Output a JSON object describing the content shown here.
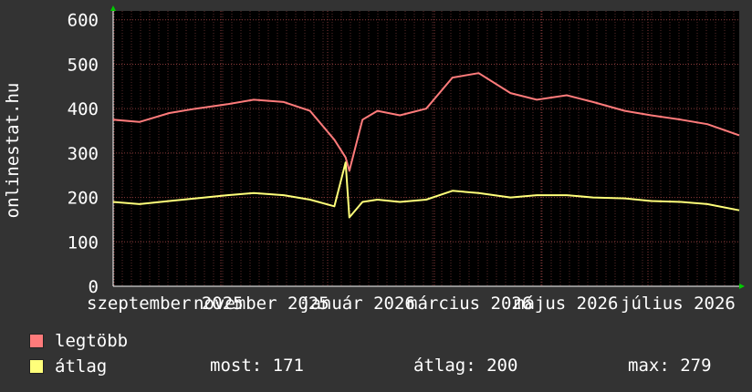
{
  "chart_data": {
    "type": "line",
    "ylabel": "onlinestat.hu",
    "ylim": [
      0,
      620
    ],
    "y_ticks": [
      0,
      100,
      200,
      300,
      400,
      500,
      600
    ],
    "x_tick_labels": [
      "szeptember 2025",
      "november 2025",
      "január 2026",
      "március 2026",
      "május 2026",
      "július 2026"
    ],
    "x_range": [
      "2025-09-01",
      "2026-08-01"
    ],
    "grid": true,
    "series": [
      {
        "name": "legtöbb",
        "color": "#ff7b7b",
        "x_dates": [
          "2025-09-01",
          "2025-09-15",
          "2025-10-01",
          "2025-10-15",
          "2025-11-01",
          "2025-11-15",
          "2025-12-01",
          "2025-12-15",
          "2025-12-28",
          "2026-01-03",
          "2026-01-05",
          "2026-01-12",
          "2026-01-20",
          "2026-02-01",
          "2026-02-15",
          "2026-03-01",
          "2026-03-15",
          "2026-04-01",
          "2026-04-15",
          "2026-05-01",
          "2026-05-15",
          "2026-06-01",
          "2026-06-15",
          "2026-07-01",
          "2026-07-15",
          "2026-08-01"
        ],
        "values": [
          375,
          370,
          390,
          400,
          410,
          420,
          415,
          395,
          330,
          290,
          260,
          375,
          395,
          385,
          400,
          470,
          480,
          435,
          420,
          430,
          415,
          395,
          385,
          375,
          365,
          340
        ]
      },
      {
        "name": "átlag",
        "color": "#ffff7a",
        "x_dates": [
          "2025-09-01",
          "2025-09-15",
          "2025-10-01",
          "2025-10-15",
          "2025-11-01",
          "2025-11-15",
          "2025-12-01",
          "2025-12-15",
          "2025-12-28",
          "2026-01-03",
          "2026-01-05",
          "2026-01-12",
          "2026-01-20",
          "2026-02-01",
          "2026-02-15",
          "2026-03-01",
          "2026-03-15",
          "2026-04-01",
          "2026-04-15",
          "2026-05-01",
          "2026-05-15",
          "2026-06-01",
          "2026-06-15",
          "2026-07-01",
          "2026-07-15",
          "2026-08-01"
        ],
        "values": [
          190,
          185,
          192,
          198,
          205,
          210,
          205,
          195,
          180,
          279,
          155,
          190,
          195,
          190,
          195,
          215,
          210,
          200,
          205,
          205,
          200,
          198,
          192,
          190,
          185,
          171
        ]
      }
    ]
  },
  "legend": {
    "max_label": "legtöbb",
    "avg_label": "átlag",
    "max_color": "#ff7b7b",
    "avg_color": "#ffff7a"
  },
  "stats": {
    "most": "most: 171",
    "atlag": "átlag: 200",
    "max": "max: 279"
  }
}
